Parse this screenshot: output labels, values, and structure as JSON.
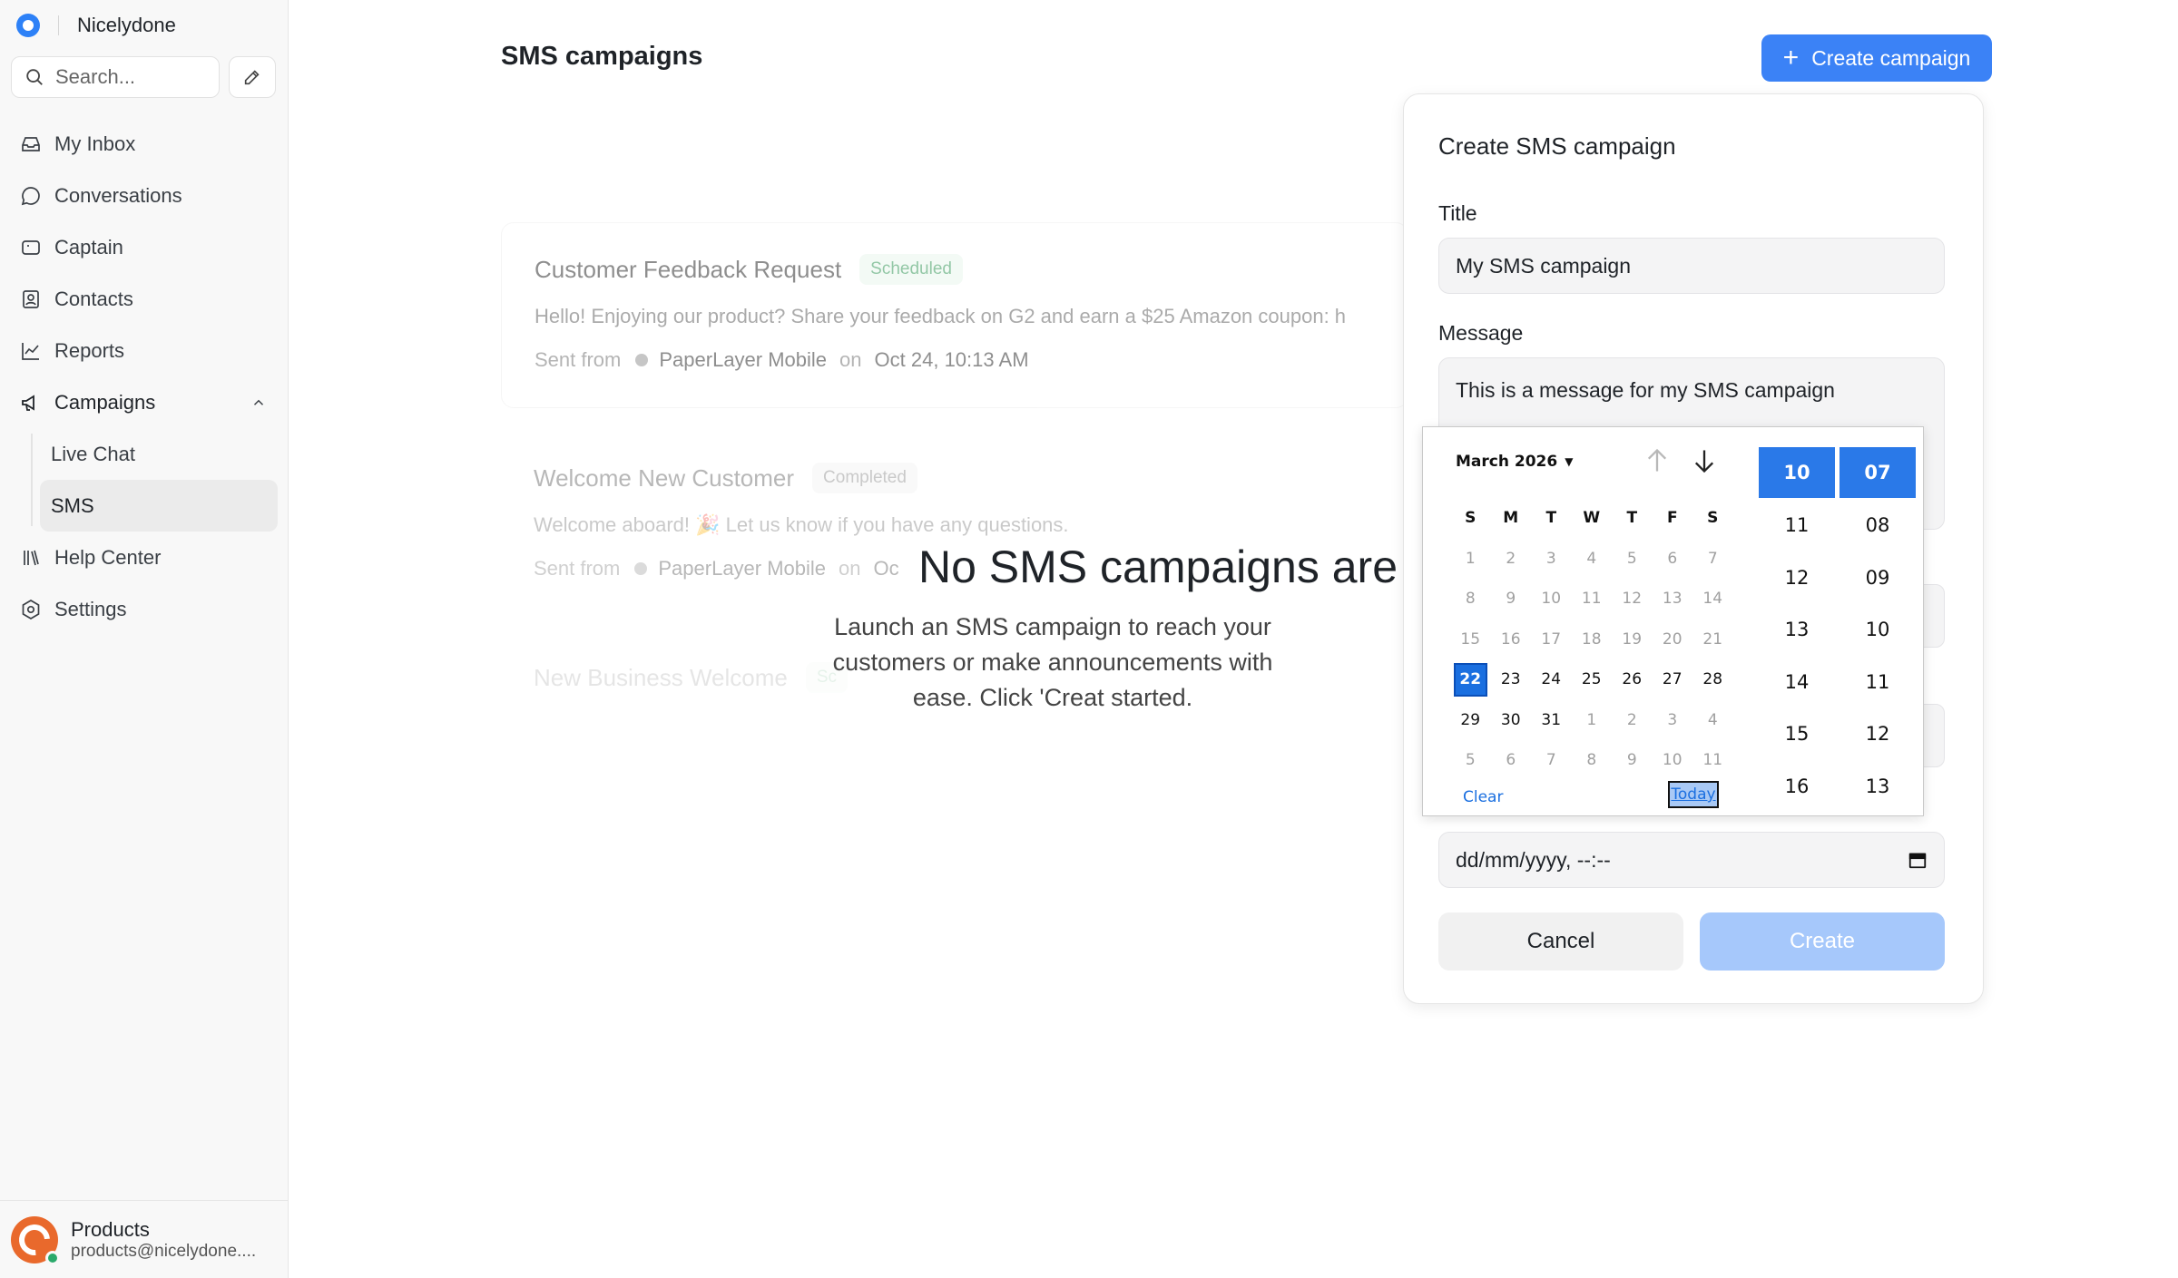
{
  "sidebar": {
    "brand": "Nicelydone",
    "search_placeholder": "Search...",
    "items": [
      {
        "label": "My Inbox",
        "icon": "inbox-icon"
      },
      {
        "label": "Conversations",
        "icon": "chat-bubble-icon"
      },
      {
        "label": "Captain",
        "icon": "captain-icon"
      },
      {
        "label": "Contacts",
        "icon": "contacts-icon"
      },
      {
        "label": "Reports",
        "icon": "chart-line-icon"
      },
      {
        "label": "Campaigns",
        "icon": "megaphone-icon",
        "expanded": true
      },
      {
        "label": "Help Center",
        "icon": "library-icon"
      },
      {
        "label": "Settings",
        "icon": "gear-icon"
      }
    ],
    "campaign_sub": [
      {
        "label": "Live Chat"
      },
      {
        "label": "SMS",
        "active": true
      }
    ],
    "account": {
      "name": "Products",
      "email": "products@nicelydone...."
    }
  },
  "main": {
    "title": "SMS campaigns",
    "create_button": "Create campaign",
    "campaigns": [
      {
        "title": "Customer Feedback Request",
        "status": "Scheduled",
        "message": "Hello! Enjoying our product? Share your feedback on G2 and earn a $25 Amazon coupon: h",
        "sent_from_label": "Sent from",
        "inbox": "PaperLayer Mobile",
        "on_label": "on",
        "date": "Oct 24, 10:13 AM"
      },
      {
        "title": "Welcome New Customer",
        "status": "Completed",
        "message": "Welcome aboard! 🎉 Let us know if you have any questions.",
        "sent_from_label": "Sent from",
        "inbox": "PaperLayer Mobile",
        "on_label": "on",
        "date": "Oc"
      },
      {
        "title": "New Business Welcome",
        "status": "Sc"
      }
    ],
    "empty_title": "No SMS campaigns are a",
    "empty_desc": "Launch an SMS campaign to reach your customers or make announcements with ease. Click 'Creat started."
  },
  "popover": {
    "title": "Create SMS campaign",
    "title_label": "Title",
    "title_value": "My SMS campaign",
    "message_label": "Message",
    "message_value": "This is a message for my SMS campaign",
    "datetime_placeholder": "dd/mm/yyyy, --:--",
    "cancel": "Cancel",
    "create": "Create"
  },
  "datepicker": {
    "month_label": "March 2026",
    "weekdays": [
      "S",
      "M",
      "T",
      "W",
      "T",
      "F",
      "S"
    ],
    "weeks": [
      [
        {
          "d": "1",
          "m": true
        },
        {
          "d": "2",
          "m": true
        },
        {
          "d": "3",
          "m": true
        },
        {
          "d": "4",
          "m": true
        },
        {
          "d": "5",
          "m": true
        },
        {
          "d": "6",
          "m": true
        },
        {
          "d": "7",
          "m": true
        }
      ],
      [
        {
          "d": "8",
          "m": true
        },
        {
          "d": "9",
          "m": true
        },
        {
          "d": "10",
          "m": true
        },
        {
          "d": "11",
          "m": true
        },
        {
          "d": "12",
          "m": true
        },
        {
          "d": "13",
          "m": true
        },
        {
          "d": "14",
          "m": true
        }
      ],
      [
        {
          "d": "15",
          "m": true
        },
        {
          "d": "16",
          "m": true
        },
        {
          "d": "17",
          "m": true
        },
        {
          "d": "18",
          "m": true
        },
        {
          "d": "19",
          "m": true
        },
        {
          "d": "20",
          "m": true
        },
        {
          "d": "21",
          "m": true
        }
      ],
      [
        {
          "d": "22",
          "s": true
        },
        {
          "d": "23"
        },
        {
          "d": "24"
        },
        {
          "d": "25"
        },
        {
          "d": "26"
        },
        {
          "d": "27"
        },
        {
          "d": "28"
        }
      ],
      [
        {
          "d": "29"
        },
        {
          "d": "30"
        },
        {
          "d": "31"
        },
        {
          "d": "1",
          "m": true
        },
        {
          "d": "2",
          "m": true
        },
        {
          "d": "3",
          "m": true
        },
        {
          "d": "4",
          "m": true
        }
      ],
      [
        {
          "d": "5",
          "m": true
        },
        {
          "d": "6",
          "m": true
        },
        {
          "d": "7",
          "m": true
        },
        {
          "d": "8",
          "m": true
        },
        {
          "d": "9",
          "m": true
        },
        {
          "d": "10",
          "m": true
        },
        {
          "d": "11",
          "m": true
        }
      ]
    ],
    "clear": "Clear",
    "today": "Today",
    "hours": [
      "10",
      "11",
      "12",
      "13",
      "14",
      "15",
      "16"
    ],
    "minutes": [
      "07",
      "08",
      "09",
      "10",
      "11",
      "12",
      "13"
    ],
    "selected_hour": "10",
    "selected_minute": "07"
  },
  "colors": {
    "accent": "#3b82f6",
    "create_disabled": "#a6c8fb",
    "scheduled_badge": "#3a9a5d",
    "picker_selected": "#1a6fe0"
  }
}
